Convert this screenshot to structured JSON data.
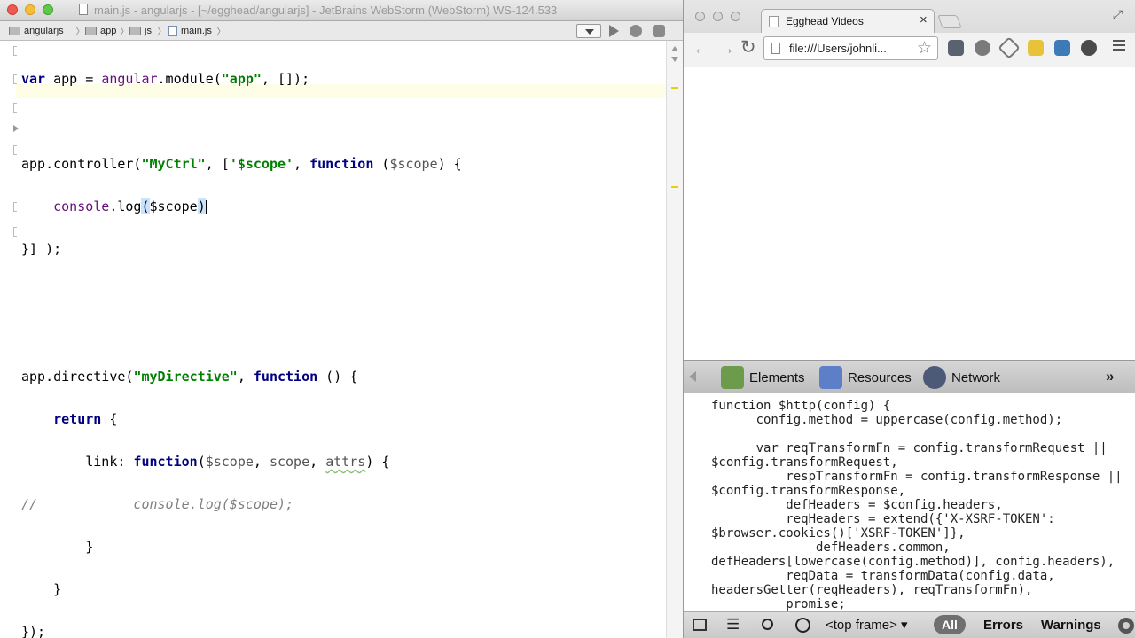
{
  "ide": {
    "title": "main.js - angularjs - [~/egghead/angularjs] - JetBrains WebStorm (WebStorm) WS-124.533",
    "breadcrumbs": [
      "angularjs",
      "app",
      "js",
      "main.js"
    ],
    "code": {
      "l1": {
        "a": "var",
        "b": " app = ",
        "c": "angular",
        "d": ".module(",
        "e": "\"app\"",
        "f": ", []);"
      },
      "l3": {
        "a": "app.controller(",
        "b": "\"MyCtrl\"",
        "c": ", [",
        "d": "'$scope'",
        "e": ", ",
        "f": "function",
        "g": " (",
        "h": "$scope",
        "i": ") {"
      },
      "l4": {
        "a": "    console",
        "b": ".log",
        "c": "(",
        "d": "$scope",
        "e": ")"
      },
      "l5": {
        "a": "}] );"
      },
      "l8": {
        "a": "app.directive(",
        "b": "\"myDirective\"",
        "c": ", ",
        "d": "function",
        "e": " () {"
      },
      "l9": {
        "a": "    ",
        "b": "return",
        "c": " {"
      },
      "l10": {
        "a": "        link: ",
        "b": "function",
        "c": "(",
        "d": "$scope",
        "e": ", ",
        "f": "scope",
        "g": ", ",
        "h": "attrs",
        "i": ") {"
      },
      "l11": {
        "a": "//",
        "b": "            console.log($scope);"
      },
      "l12": {
        "a": "        }"
      },
      "l13": {
        "a": "    }"
      },
      "l14": {
        "a": "});"
      }
    }
  },
  "browser": {
    "tab_title": "Egghead Videos",
    "tab_close": "×",
    "url": "file:///Users/johnli...",
    "back": "←",
    "forward": "→",
    "reload": "↻",
    "star": "☆",
    "fullscreen": "⤢",
    "devtools_tabs": [
      "Elements",
      "Resources",
      "Network"
    ],
    "more": "»",
    "console_lines": [
      "function $http(config) {",
      "      config.method = uppercase(config.method);",
      "",
      "      var reqTransformFn = config.transformRequest ||",
      "$config.transformRequest,",
      "          respTransformFn = config.transformResponse ||",
      "$config.transformResponse,",
      "          defHeaders = $config.headers,",
      "          reqHeaders = extend({'X-XSRF-TOKEN':",
      "$browser.cookies()['XSRF-TOKEN']},",
      "              defHeaders.common,",
      "defHeaders[lowercase(config.method)], config.headers),",
      "          reqData = transformData(config.data,",
      "headersGetter(reqHeaders), reqTransformFn),",
      "          promise;"
    ],
    "status": {
      "frame": "<top frame>",
      "all": "All",
      "errors": "Errors",
      "warnings": "Warnings"
    }
  },
  "colors": {
    "keyword": "#000080",
    "string": "#008000",
    "global": "#660e7a",
    "current_line": "#fefee6"
  }
}
